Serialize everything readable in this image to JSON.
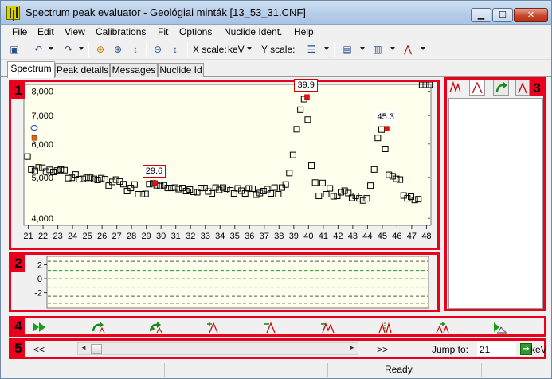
{
  "window": {
    "title": "Spectrum peak evaluator - Geológiai minták [13_53_31.CNF]"
  },
  "menu": [
    "File",
    "Edit",
    "View",
    "Calibrations",
    "Fit",
    "Options",
    "Nuclide Ident.",
    "Help"
  ],
  "toolbar": {
    "xscale_label": "X scale:",
    "xscale_value": "keV",
    "yscale_label": "Y scale:"
  },
  "tabs": [
    "Spectrum",
    "Peak details",
    "Messages",
    "Nuclide Id"
  ],
  "panels": {
    "main": "1",
    "residual": "2",
    "side": "3",
    "fit_tools": "4",
    "navigation": "5"
  },
  "navigation": {
    "prev": "<<",
    "next": ">>",
    "jump_label": "Jump to:",
    "jump_value": "21",
    "unit": "keV"
  },
  "status": {
    "text": "Ready."
  },
  "colors": {
    "accent": "#e8001c",
    "plot_bg": "#ffffee",
    "peak_marker": "#e81010"
  },
  "chart_data": [
    {
      "type": "scatter",
      "scale": "log",
      "x_ticks": [
        21,
        22,
        23,
        24,
        25,
        26,
        27,
        28,
        29,
        30,
        31,
        32,
        33,
        34,
        35,
        36,
        37,
        38,
        39,
        40,
        41,
        42,
        43,
        44,
        45,
        46,
        47,
        48
      ],
      "y_ticks": [
        "4,000",
        "5,000",
        "6,000",
        "7,000",
        "8,000"
      ],
      "y_tick_values": [
        4000,
        5000,
        6000,
        7000,
        8000
      ],
      "xlim": [
        20.7,
        48.3
      ],
      "ylim": [
        3850,
        8300
      ],
      "x": [
        20.95,
        21.2,
        21.45,
        21.7,
        21.95,
        22.2,
        22.45,
        22.7,
        22.95,
        23.2,
        23.45,
        23.7,
        23.95,
        24.2,
        24.45,
        24.7,
        24.95,
        25.2,
        25.45,
        25.7,
        25.95,
        26.2,
        26.45,
        26.7,
        26.95,
        27.2,
        27.45,
        27.7,
        27.95,
        28.2,
        28.45,
        28.7,
        28.95,
        29.2,
        29.45,
        29.7,
        29.95,
        30.2,
        30.45,
        30.7,
        30.95,
        31.2,
        31.45,
        31.7,
        31.95,
        32.2,
        32.45,
        32.7,
        32.95,
        33.2,
        33.45,
        33.7,
        33.95,
        34.2,
        34.45,
        34.7,
        34.95,
        35.2,
        35.45,
        35.7,
        35.95,
        36.2,
        36.45,
        36.7,
        36.95,
        37.2,
        37.45,
        37.7,
        37.95,
        38.2,
        38.45,
        38.7,
        38.95,
        39.2,
        39.45,
        39.7,
        39.95,
        40.2,
        40.45,
        40.7,
        40.95,
        41.2,
        41.45,
        41.7,
        41.95,
        42.2,
        42.45,
        42.7,
        42.95,
        43.2,
        43.45,
        43.7,
        43.95,
        44.2,
        44.45,
        44.7,
        44.95,
        45.2,
        45.45,
        45.7,
        45.95,
        46.2,
        46.45,
        46.7,
        46.95,
        47.2,
        47.45,
        47.7,
        47.95,
        48.2
      ],
      "y": [
        5600,
        5220,
        5180,
        5280,
        5270,
        5160,
        5210,
        5150,
        5190,
        5220,
        5200,
        4980,
        4990,
        5080,
        4950,
        4960,
        4990,
        4990,
        4960,
        4930,
        4980,
        4950,
        4780,
        4880,
        4940,
        4890,
        4820,
        4640,
        4720,
        4810,
        4560,
        4560,
        4570,
        4820,
        4840,
        4790,
        4770,
        4790,
        4720,
        4720,
        4730,
        4690,
        4720,
        4640,
        4680,
        4620,
        4610,
        4720,
        4720,
        4630,
        4580,
        4730,
        4670,
        4730,
        4700,
        4660,
        4580,
        4710,
        4650,
        4580,
        4710,
        4700,
        4550,
        4590,
        4640,
        4690,
        4580,
        4730,
        4560,
        4730,
        4810,
        5120,
        5650,
        6500,
        7230,
        7660,
        6850,
        5330,
        4860,
        4520,
        4850,
        4560,
        4710,
        4510,
        4520,
        4610,
        4650,
        4590,
        4470,
        4520,
        4460,
        4410,
        4460,
        4780,
        5220,
        6200,
        6490,
        5840,
        5070,
        5030,
        4960,
        4940,
        4530,
        4460,
        4500,
        4420,
        4440
      ],
      "peak_labels": [
        {
          "x": 29.6,
          "y": 4850,
          "text": "29.6"
        },
        {
          "x": 39.9,
          "y": 7750,
          "text": "39.9"
        },
        {
          "x": 45.3,
          "y": 6520,
          "text": "45.3"
        }
      ]
    },
    {
      "type": "line",
      "name": "residual",
      "y_ticks": [
        "2",
        "0",
        "-2"
      ],
      "y_tick_values": [
        2,
        0,
        -2
      ],
      "ylim": [
        -4.2,
        3.2
      ],
      "dashed_levels": [
        -3.5,
        -2.5,
        -1.2,
        0,
        1.2,
        2.5
      ]
    }
  ]
}
